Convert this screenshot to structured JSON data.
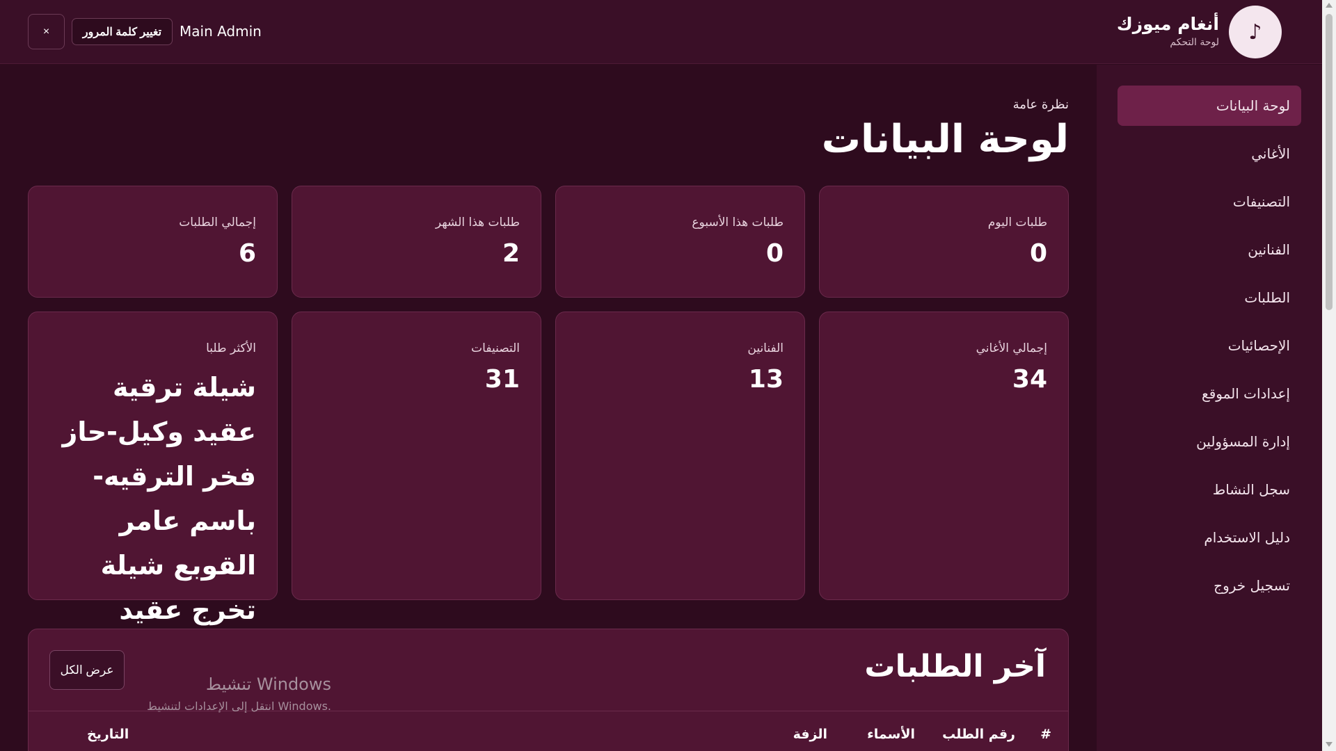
{
  "header": {
    "brand_name": "أنغام ميوزك",
    "brand_sub": "لوحة التحكم",
    "logo_glyph": "♪",
    "close_label": "×",
    "change_password_label": "تغيير كلمة المرور",
    "user_name": "Main Admin"
  },
  "sidebar": {
    "items": [
      {
        "label": "لوحة البيانات",
        "active": true
      },
      {
        "label": "الأغاني"
      },
      {
        "label": "التصنيفات"
      },
      {
        "label": "الفنانين"
      },
      {
        "label": "الطلبات"
      },
      {
        "label": "الإحصائيات"
      },
      {
        "label": "إعدادات الموقع"
      },
      {
        "label": "إدارة المسؤولين"
      },
      {
        "label": "سجل النشاط"
      },
      {
        "label": "دليل الاستخدام"
      },
      {
        "label": "تسجيل خروج"
      }
    ]
  },
  "main": {
    "eyebrow": "نظرة عامة",
    "title": "لوحة البيانات",
    "stats_row1": [
      {
        "label": "طلبات اليوم",
        "value": "0"
      },
      {
        "label": "طلبات هذا الأسبوع",
        "value": "0"
      },
      {
        "label": "طلبات هذا الشهر",
        "value": "2"
      },
      {
        "label": "إجمالي الطلبات",
        "value": "6"
      }
    ],
    "stats_row2": [
      {
        "label": "إجمالي الأغاني",
        "value": "34"
      },
      {
        "label": "الفنانين",
        "value": "13"
      },
      {
        "label": "التصنيفات",
        "value": "31"
      },
      {
        "label": "الأكثر طلبا",
        "value": "شيلة ترقية عقيد وكيل-حاز فخر الترقيه-باسم عامر القوبع شيلة تخرج عقيد"
      }
    ]
  },
  "recent": {
    "title": "آخر الطلبات",
    "view_all_label": "عرض الكل",
    "columns": [
      "#",
      "رقم الطلب",
      "الأسماء",
      "الزفة",
      "التاريخ"
    ]
  },
  "watermark": {
    "title": "تنشيط Windows",
    "subtitle": "انتقل إلى الإعدادات لتنشيط Windows."
  },
  "colors": {
    "background": "#2e0b1e",
    "panel": "#3a0f27",
    "card": "#501533",
    "active_nav": "#6e2149"
  }
}
